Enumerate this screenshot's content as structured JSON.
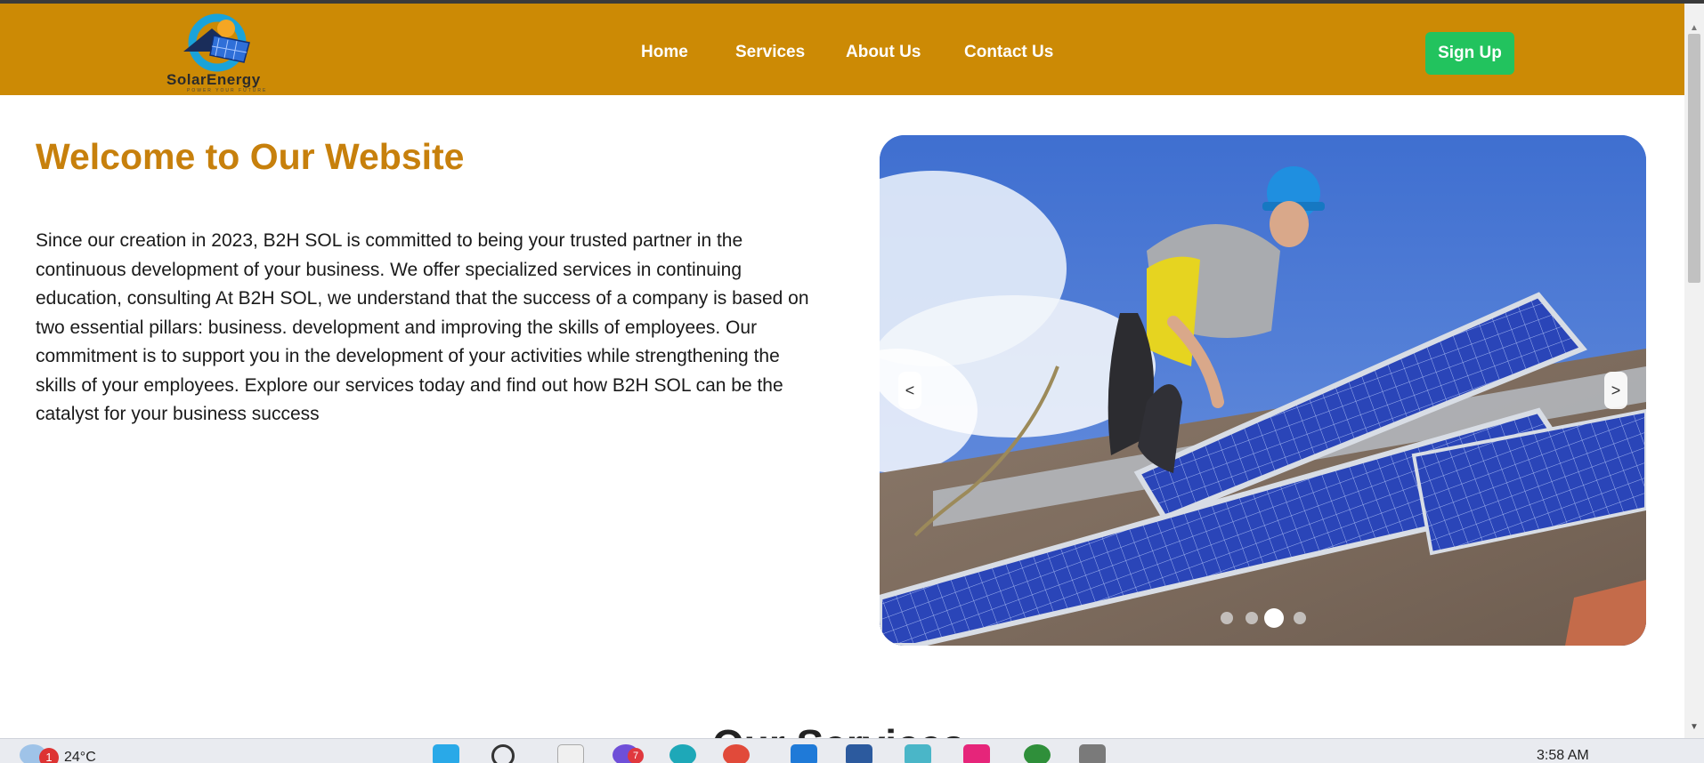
{
  "brand": {
    "name": "SolarEnergy",
    "tagline": "POWER YOUR FUTURE"
  },
  "nav": {
    "items": [
      {
        "label": "Home"
      },
      {
        "label": "Services"
      },
      {
        "label": "About Us"
      },
      {
        "label": "Contact Us"
      }
    ],
    "signup_label": "Sign Up"
  },
  "hero": {
    "title": "Welcome to Our Website",
    "paragraph": "Since our creation in 2023, B2H SOL is committed to being your trusted partner in the continuous development of your business. We offer specialized services in continuing education, consulting At B2H SOL, we understand that the success of a company is based on two essential pillars: business. development and improving the skills of employees. Our commitment is to support you in the development of your activities while strengthening the skills of your employees. Explore our services today and find out how B2H SOL can be the catalyst for your business success"
  },
  "carousel": {
    "prev_label": "<",
    "next_label": ">",
    "slide_count": 4,
    "active_slide": 3,
    "image_subject": "worker installing solar panels on roof"
  },
  "section_next": {
    "heading_partial": "Our Services"
  },
  "taskbar": {
    "weather_badge": "1",
    "temperature": "24°C",
    "app_badge": "7",
    "time": "3:58 AM"
  },
  "colors": {
    "navbar": "#cc8a05",
    "title": "#c7800c",
    "signup": "#22c35e",
    "sky": "#4a78d4"
  }
}
